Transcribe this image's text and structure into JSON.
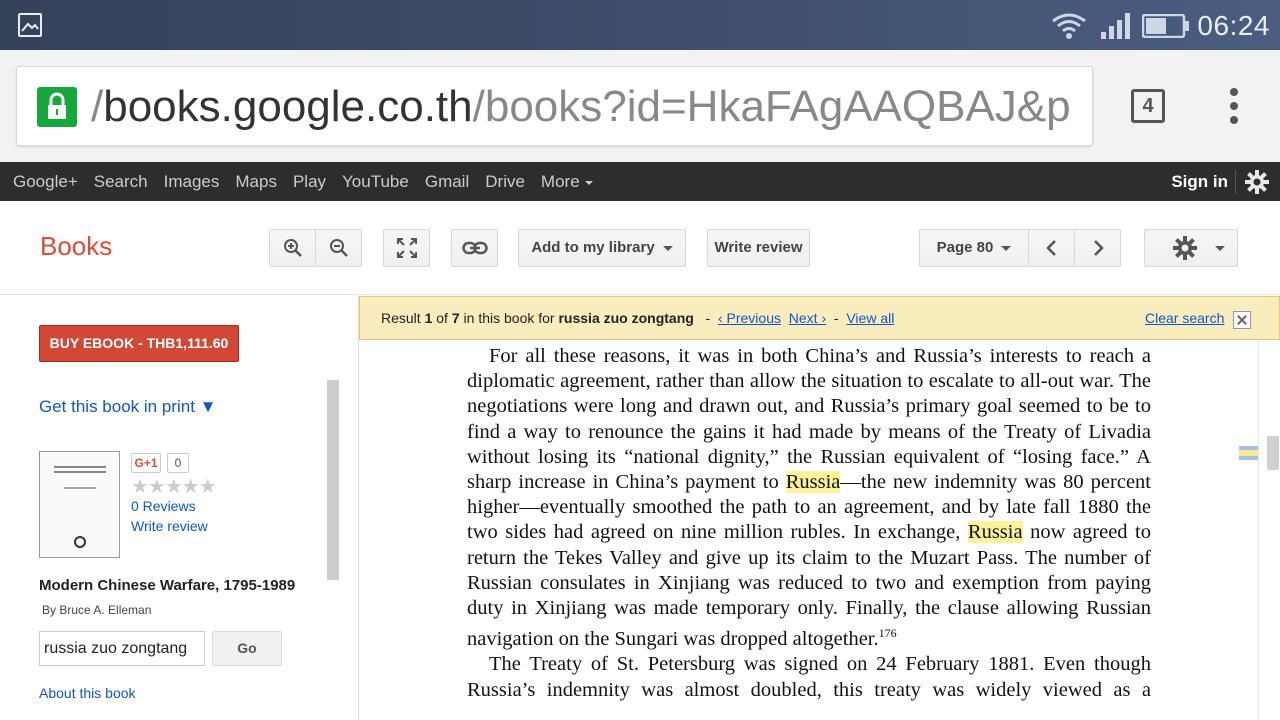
{
  "status_bar": {
    "time": "06:24",
    "icons": [
      "gallery-icon",
      "wifi-icon",
      "signal-icon",
      "battery-icon"
    ]
  },
  "browser": {
    "url_prefix": "/",
    "url_host": "books.google.co.th",
    "url_path": "/books?id=HkaFAgAAQBAJ&p",
    "tab_count": "4"
  },
  "google_bar": {
    "links": [
      "Google+",
      "Search",
      "Images",
      "Maps",
      "Play",
      "YouTube",
      "Gmail",
      "Drive",
      "More"
    ],
    "sign_in": "Sign in"
  },
  "toolbar": {
    "title": "Books",
    "add_to_library": "Add to my library",
    "write_review": "Write review",
    "page_label": "Page 80"
  },
  "sidebar": {
    "buy_button": "BUY EBOOK - THB1,111.60",
    "get_print": "Get this book in print ▼",
    "gplus_label": "G+1",
    "gplus_count": "0",
    "stars": "★★★★★",
    "reviews_link": "0 Reviews",
    "write_review_link": "Write review",
    "book_title": "Modern Chinese Warfare, 1795-1989",
    "byline": "By Bruce A. Elleman",
    "search_value": "russia zuo zongtang",
    "go_button": "Go",
    "about_link": "About this book"
  },
  "result_bar": {
    "result_word": "Result",
    "result_index": "1",
    "of_word": "of",
    "result_total": "7",
    "in_book_text": "in this book for",
    "query": "russia zuo zongtang",
    "previous": "‹ Previous",
    "next": "Next ›",
    "view_all": "View all",
    "clear_search": "Clear search"
  },
  "page_text": {
    "p1_a": "For all these reasons, it was in both China’s and Russia’s interests to reach a diplomatic agreement, rather than allow the situation to escalate to all-out war. The negotiations were long and drawn out, and Russia’s primary goal seemed to be to find a way to renounce the gains it had made by means of the Treaty of Livadia without losing its “national dignity,” the Russian equivalent of “losing face.” A sharp increase in China’s payment to ",
    "p1_hl1": "Russia",
    "p1_b": "—the new indemnity was 80 percent higher—eventually smoothed the path to an agreement, and by late fall 1880 the two sides had agreed on nine million rubles. In exchange, ",
    "p1_hl2": "Russia",
    "p1_c": " now agreed to return the Tekes Valley and give up its claim to the Muzart Pass. The number of Russian consulates in Xinjiang was reduced to two and exemption from paying duty in Xinjiang was made temporary only. Finally, the clause allowing Russian navigation on the Sungari was dropped altogether.",
    "p1_note": "176",
    "p2": "The Treaty of St. Petersburg was signed on 24 February 1881. Even though Russia’s indemnity was almost doubled, this treaty was widely viewed as a"
  }
}
